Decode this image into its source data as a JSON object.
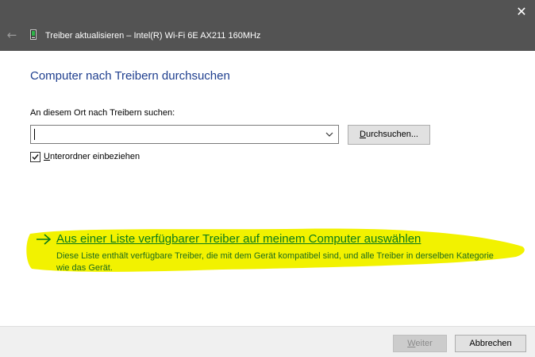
{
  "titlebar": {
    "title": "Treiber aktualisieren – Intel(R) Wi-Fi 6E AX211 160MHz",
    "back_icon": "back-arrow-icon",
    "close_icon": "close-icon",
    "device_icon": "network-adapter-icon"
  },
  "main": {
    "heading": "Computer nach Treibern durchsuchen",
    "path_label": "An diesem Ort nach Treibern suchen:",
    "path_value": "",
    "browse_label_mnemonic": "D",
    "browse_label_rest": "urchsuchen...",
    "include_checked": true,
    "include_label_mnemonic": "U",
    "include_label_rest": "nterordner einbeziehen",
    "pick_from_list": {
      "link_text": "Aus einer Liste verfügbarer Treiber auf meinem Computer auswählen",
      "description": "Diese Liste enthält verfügbare Treiber, die mit dem Gerät kompatibel sind, und alle Treiber in derselben Kategorie wie das Gerät."
    }
  },
  "footer": {
    "next_mnemonic": "W",
    "next_rest": "eiter",
    "cancel_label": "Abbrechen"
  },
  "colors": {
    "titlebar": "#535353",
    "heading": "#1f3f8f",
    "link_green": "#0a7a1a",
    "highlighter": "#f2f200",
    "footer": "#f0f0f0"
  }
}
